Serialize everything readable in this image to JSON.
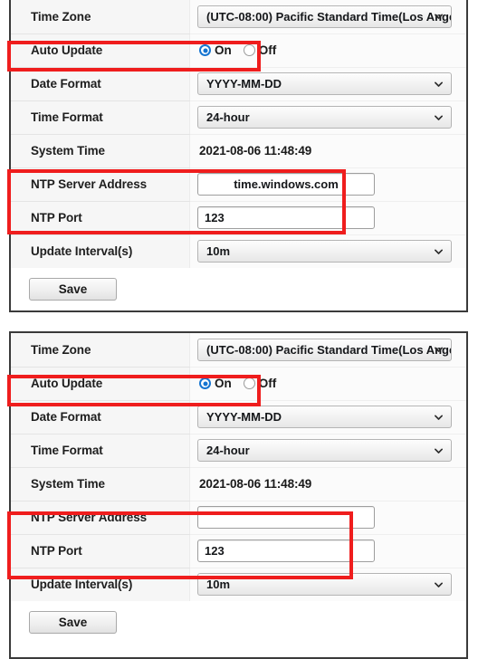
{
  "panels": [
    {
      "id": "panel-1",
      "rows": [
        {
          "label": "Time Zone",
          "type": "dropdown",
          "value": "(UTC-08:00) Pacific Standard Time(Los Ange"
        },
        {
          "label": "Auto Update",
          "type": "radio",
          "options": [
            "On",
            "Off"
          ],
          "selected": "On"
        },
        {
          "label": "Date Format",
          "type": "dropdown",
          "value": "YYYY-MM-DD"
        },
        {
          "label": "Time Format",
          "type": "dropdown",
          "value": "24-hour"
        },
        {
          "label": "System Time",
          "type": "static",
          "value": "2021-08-06 11:48:49"
        },
        {
          "label": "NTP Server Address",
          "type": "input",
          "value": "time.windows.com",
          "align": "center"
        },
        {
          "label": "NTP Port",
          "type": "input",
          "value": "123",
          "align": "left"
        },
        {
          "label": "Update Interval(s)",
          "type": "dropdown",
          "value": "10m"
        }
      ],
      "save_label": "Save"
    },
    {
      "id": "panel-2",
      "rows": [
        {
          "label": "Time Zone",
          "type": "dropdown",
          "value": "(UTC-08:00) Pacific Standard Time(Los Ange"
        },
        {
          "label": "Auto Update",
          "type": "radio",
          "options": [
            "On",
            "Off"
          ],
          "selected": "On"
        },
        {
          "label": "Date Format",
          "type": "dropdown",
          "value": "YYYY-MM-DD"
        },
        {
          "label": "Time Format",
          "type": "dropdown",
          "value": "24-hour"
        },
        {
          "label": "System Time",
          "type": "static",
          "value": "2021-08-06 11:48:49"
        },
        {
          "label": "NTP Server Address",
          "type": "input",
          "value": "",
          "align": "left"
        },
        {
          "label": "NTP Port",
          "type": "input",
          "value": "123",
          "align": "left"
        },
        {
          "label": "Update Interval(s)",
          "type": "dropdown",
          "value": "10m"
        }
      ],
      "save_label": "Save"
    }
  ],
  "colors": {
    "highlight": "#ef1d1d",
    "radio_selected": "#1675d1",
    "label_background": "#f6f6f6"
  },
  "icons": {
    "dropdown_caret": "chevron-down-icon"
  }
}
